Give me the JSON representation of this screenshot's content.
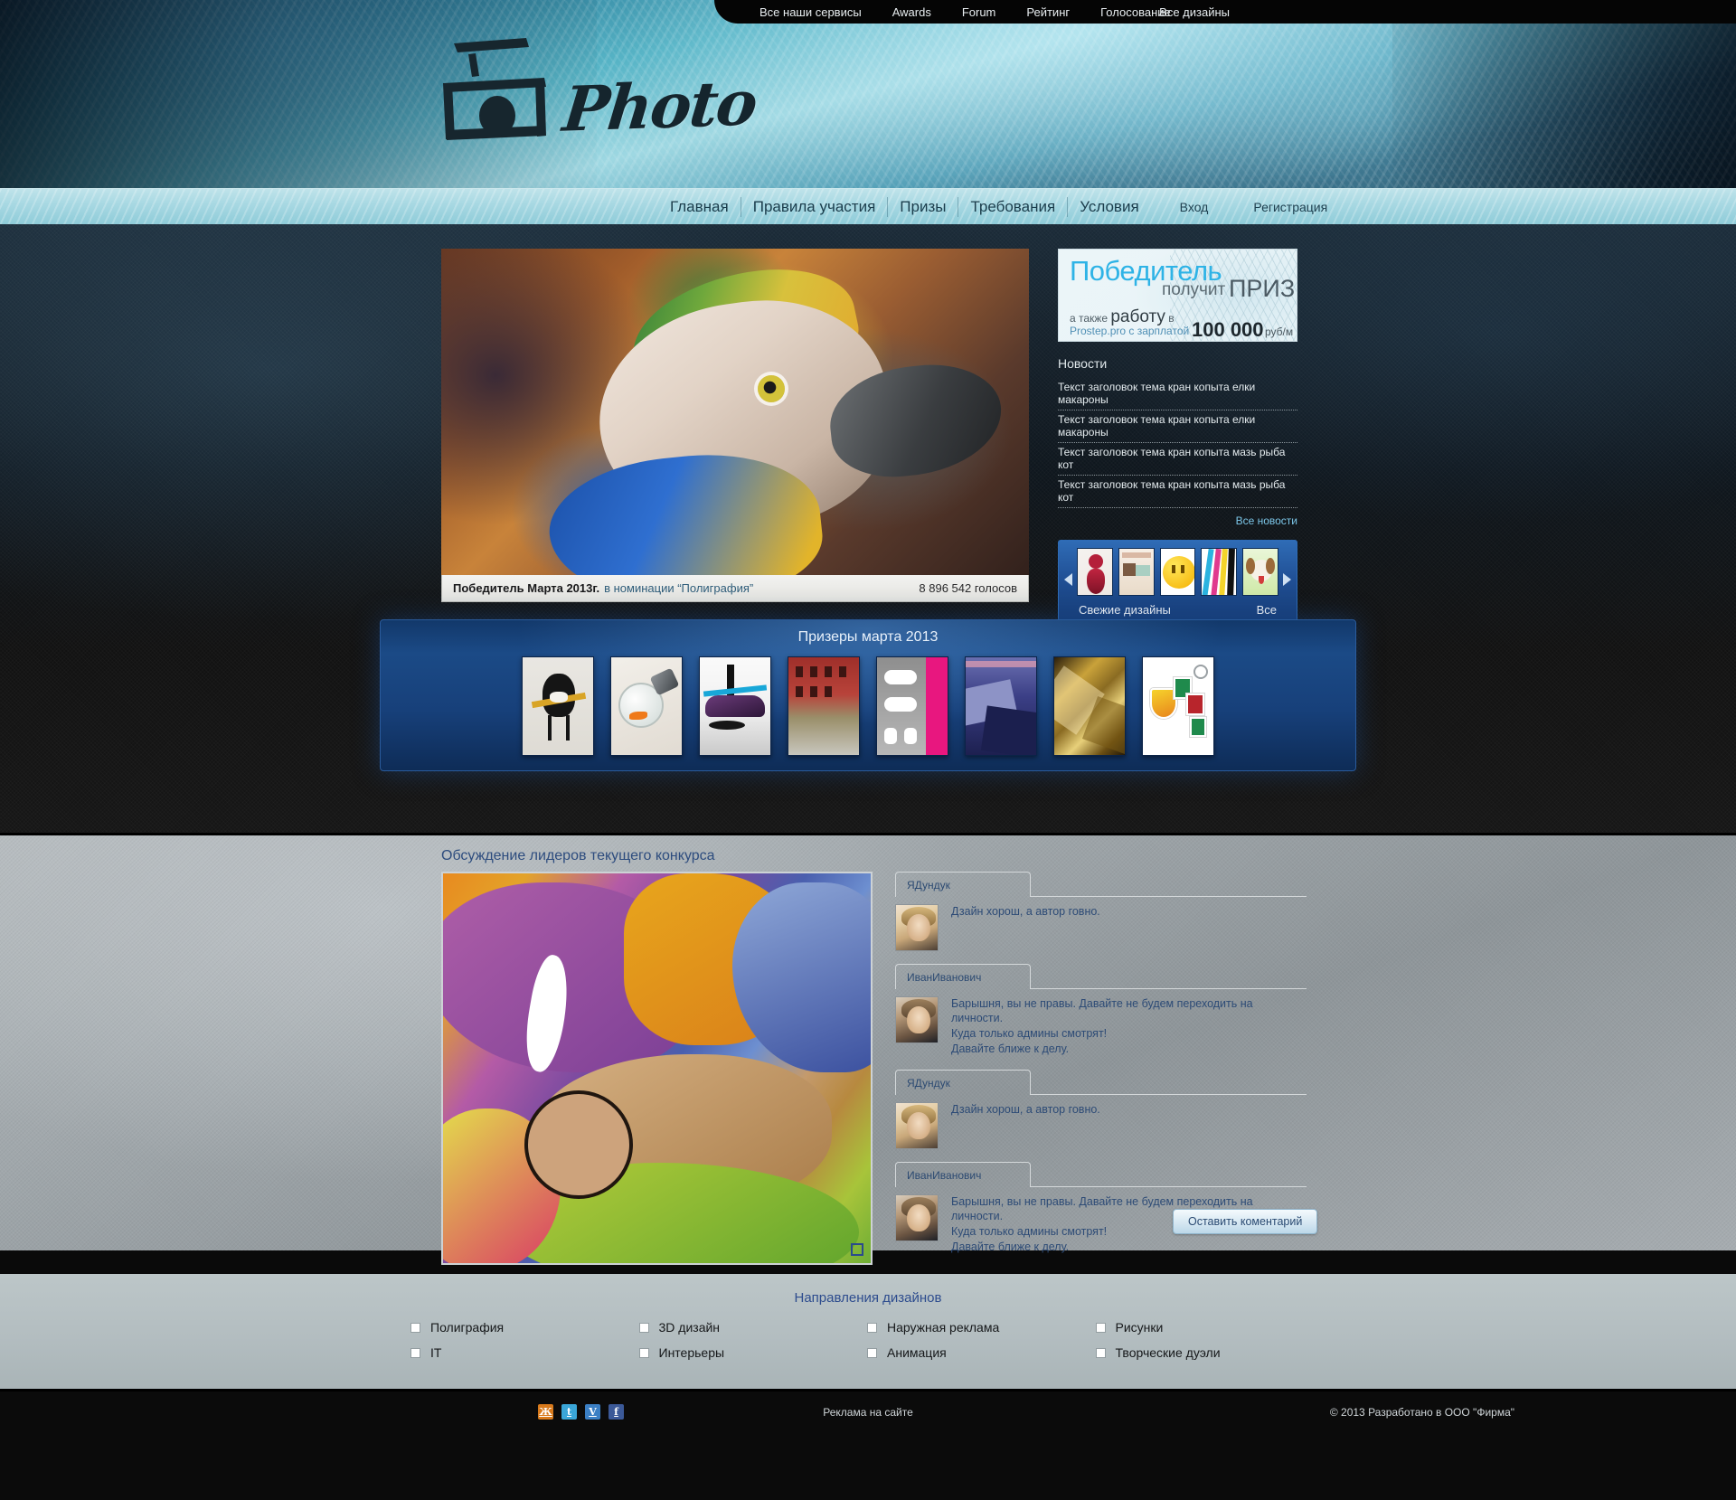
{
  "topbar": {
    "items": [
      {
        "label": "Все наши сервисы"
      },
      {
        "label": "Awards"
      },
      {
        "label": "Forum"
      },
      {
        "label": "Рейтинг"
      },
      {
        "label": "Голосование"
      }
    ],
    "right_link": "Все дизайны"
  },
  "logo": {
    "mark": "⌸",
    "word": "Photo"
  },
  "nav": {
    "items": [
      {
        "label": "Главная"
      },
      {
        "label": "Правила участия"
      },
      {
        "label": "Призы"
      },
      {
        "label": "Требования"
      },
      {
        "label": "Условия"
      }
    ],
    "auth": [
      {
        "label": "Вход"
      },
      {
        "label": "Регистрация"
      }
    ]
  },
  "hero": {
    "caption_bold": "Победитель Марта 2013г.",
    "caption_rest": "в номинации “Полиграфия”",
    "votes": "8 896 542 голосов"
  },
  "prize": {
    "line1": "Победитель",
    "line2": "получит",
    "line3": "ПРИЗ",
    "line4_prefix": "а также",
    "line4_strong": "работу",
    "line4_suffix": "в",
    "line5": "Prostep.pro с зарплатой",
    "amount": "100 000",
    "unit": "руб/м"
  },
  "news": {
    "title": "Новости",
    "items": [
      {
        "label": "Текст заголовок тема кран копыта елки макароны"
      },
      {
        "label": "Текст заголовок тема кран копыта елки макароны"
      },
      {
        "label": "Текст заголовок тема кран копыта мазь рыба  кот"
      },
      {
        "label": "Текст заголовок тема кран копыта мазь рыба  кот"
      }
    ],
    "all_label": "Все новости"
  },
  "designs": {
    "label": "Свежие дизайны",
    "all_label": "Все",
    "thumbs": [
      {
        "name": "red-pattern-shoe"
      },
      {
        "name": "sample-text-card"
      },
      {
        "name": "smiley-face"
      },
      {
        "name": "cmyk-stripes"
      },
      {
        "name": "cartoon-dog"
      }
    ]
  },
  "winners": {
    "title": "Призеры марта 2013",
    "cards": [
      {
        "name": "black-monster-sketch"
      },
      {
        "name": "goldfish-lightbulb"
      },
      {
        "name": "purple-splash-car"
      },
      {
        "name": "red-building-painting"
      },
      {
        "name": "boo-designing-21st-century"
      },
      {
        "name": "blue-mountain-landscape"
      },
      {
        "name": "gold-polygon-abstract"
      },
      {
        "name": "colored-shields-keychain"
      }
    ]
  },
  "discussion": {
    "title": "Обсуждение лидеров текущего конкурса",
    "image_name": "graffiti-artwork",
    "comments": [
      {
        "author": "ЯДундук",
        "avatar": "female",
        "lines": [
          "Дзайн хорош, а автор говно."
        ]
      },
      {
        "author": "ИванИванович",
        "avatar": "male",
        "lines": [
          "Барышня, вы не правы. Давайте не будем переходить на личности.",
          "Куда только админы смотрят!",
          "Давайте ближе к делу."
        ]
      },
      {
        "author": "ЯДундук",
        "avatar": "female",
        "lines": [
          "Дзайн хорош, а автор говно."
        ]
      },
      {
        "author": "ИванИванович",
        "avatar": "male",
        "lines": [
          "Барышня, вы не правы. Давайте не будем переходить на личности.",
          "Куда только админы смотрят!",
          "Давайте ближе к делу."
        ]
      }
    ],
    "button_label": "Оставить коментарий"
  },
  "directions": {
    "title": "Направления дизайнов",
    "items": [
      {
        "label": "Полиграфия"
      },
      {
        "label": "3D дизайн"
      },
      {
        "label": "Наружная реклама"
      },
      {
        "label": "Рисунки"
      },
      {
        "label": "IT"
      },
      {
        "label": "Интерьеры"
      },
      {
        "label": "Анимация"
      },
      {
        "label": "Творческие дуэли"
      }
    ]
  },
  "footer": {
    "socials": [
      {
        "name": "livejournal-icon",
        "glyph": "Ж",
        "color": "#d87a1c"
      },
      {
        "name": "twitter-icon",
        "glyph": "t",
        "color": "#3aa6d8"
      },
      {
        "name": "vimeo-icon",
        "glyph": "V",
        "color": "#3b7fc4"
      },
      {
        "name": "facebook-icon",
        "glyph": "f",
        "color": "#3b5998"
      }
    ],
    "ads_label": "Реклама на сайте",
    "copyright": "© 2013 Разработано в ООО \"Фирма\""
  },
  "colors": {
    "accent_blue": "#2eb3e6",
    "nav_bg": "#a9d9e3",
    "winners_bg": "#17407a",
    "link_blue": "#2d4c7e"
  }
}
